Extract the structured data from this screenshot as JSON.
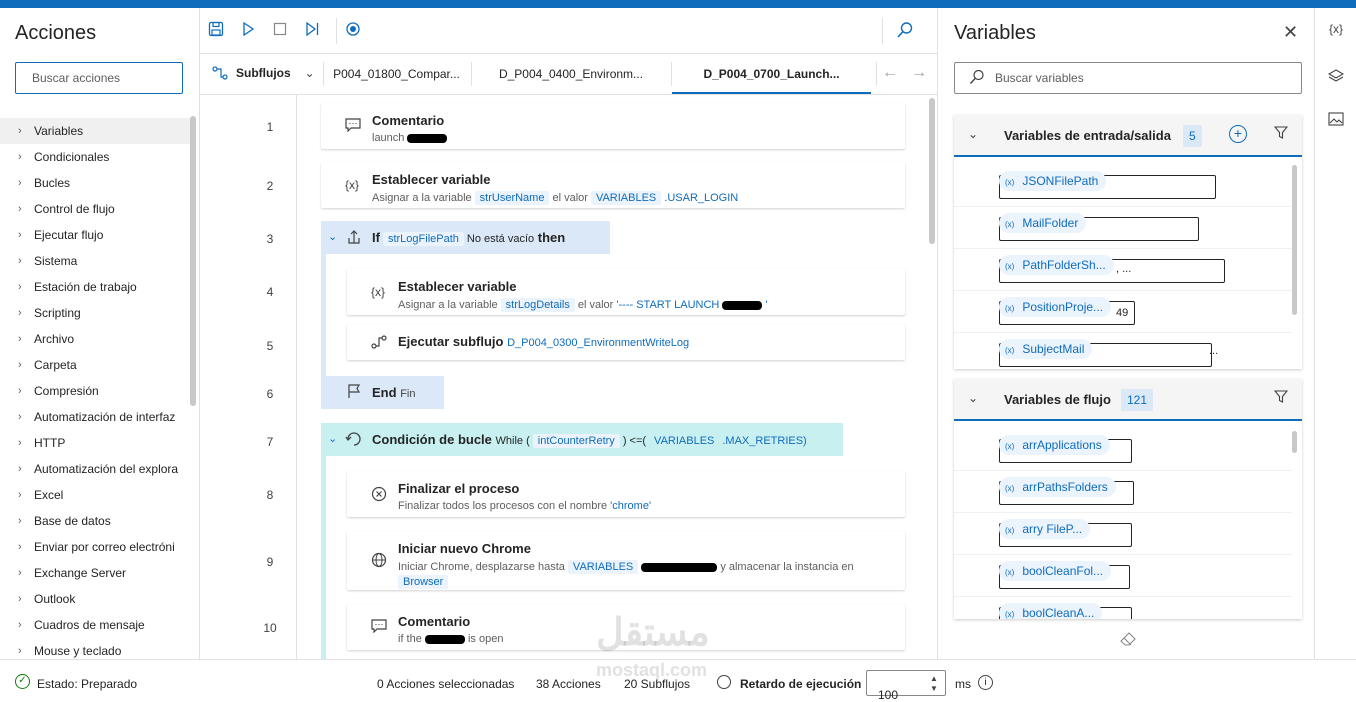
{
  "actions_panel": {
    "title": "Acciones",
    "search_placeholder": "Buscar acciones",
    "items": [
      "Variables",
      "Condicionales",
      "Bucles",
      "Control de flujo",
      "Ejecutar flujo",
      "Sistema",
      "Estación de trabajo",
      "Scripting",
      "Archivo",
      "Carpeta",
      "Compresión",
      "Automatización de interfaz",
      "HTTP",
      "Automatización del explora",
      "Excel",
      "Base de datos",
      "Enviar por correo electróni",
      "Exchange Server",
      "Outlook",
      "Cuadros de mensaje",
      "Mouse y teclado"
    ]
  },
  "tabs": {
    "subflows_label": "Subflujos",
    "items": [
      "P004_01800_Compar...",
      "D_P004_0400_Environm...",
      "D_P004_0700_Launch..."
    ]
  },
  "steps": {
    "s1": {
      "num": "1",
      "title": "Comentario",
      "desc": "launch"
    },
    "s2": {
      "num": "2",
      "title": "Establecer variable",
      "pre": "Asignar a la variable",
      "var": "strUserName",
      "mid": "el valor",
      "tok": "VARIABLES",
      "rest": ".USAR_LOGIN"
    },
    "s3": {
      "num": "3",
      "kw": "If",
      "var": "strLogFilePath",
      "cond": "No está vacío",
      "then": "then"
    },
    "s4": {
      "num": "4",
      "title": "Establecer variable",
      "pre": "Asignar a la variable",
      "var": "strLogDetails",
      "mid": "el valor",
      "val": "'---- START LAUNCH",
      "end": "'"
    },
    "s5": {
      "num": "5",
      "title": "Ejecutar subflujo",
      "target": "D_P004_0300_EnvironmentWriteLog"
    },
    "s6": {
      "num": "6",
      "title": "End",
      "desc": "Fin"
    },
    "s7": {
      "num": "7",
      "title": "Condición de bucle",
      "w1": "While (",
      "var": "intCounterRetry",
      "op": ") <=(",
      "tok": "VARIABLES",
      "rest": ".MAX_RETRIES)"
    },
    "s8": {
      "num": "8",
      "title": "Finalizar el proceso",
      "pre": "Finalizar todos los procesos con el nombre",
      "val": "'chrome'"
    },
    "s9": {
      "num": "9",
      "title": "Iniciar nuevo Chrome",
      "pre": "Iniciar Chrome, desplazarse hasta",
      "tok": "VARIABLES",
      "post": "y almacenar la instancia en",
      "store": "Browser"
    },
    "s10": {
      "num": "10",
      "title": "Comentario",
      "d1": "if the",
      "d2": "is open"
    }
  },
  "variables_panel": {
    "title": "Variables",
    "search_placeholder": "Buscar variables",
    "io": {
      "title": "Variables de entrada/salida",
      "count": "5",
      "items": [
        {
          "name": "JSONFilePath",
          "value": ""
        },
        {
          "name": "MailFolder",
          "value": ""
        },
        {
          "name": "PathFolderSh...",
          "value": ",                              ..."
        },
        {
          "name": "PositionProje...",
          "value": "49"
        },
        {
          "name": "SubjectMail",
          "value": "..."
        }
      ]
    },
    "flow": {
      "title": "Variables de flujo",
      "count": "121",
      "items": [
        {
          "name": "arrApplications"
        },
        {
          "name": "arrPathsFolders"
        },
        {
          "name": "arry    FileP..."
        },
        {
          "name": "boolCleanFol..."
        },
        {
          "name": "boolCleanA..."
        }
      ]
    }
  },
  "status_bar": {
    "state": "Estado: Preparado",
    "selected": "0 Acciones seleccionadas",
    "actions": "38 Acciones",
    "subflows": "20 Subflujos",
    "delay_label": "Retardo de ejecución",
    "delay_value": "100",
    "unit": "ms"
  },
  "watermark": {
    "line1": "مستقل",
    "line2": "mostaql.com"
  },
  "colors": {
    "accent": "#0f6cbd",
    "if_block": "#dbe8f7",
    "loop_block": "#c9f0f1"
  }
}
